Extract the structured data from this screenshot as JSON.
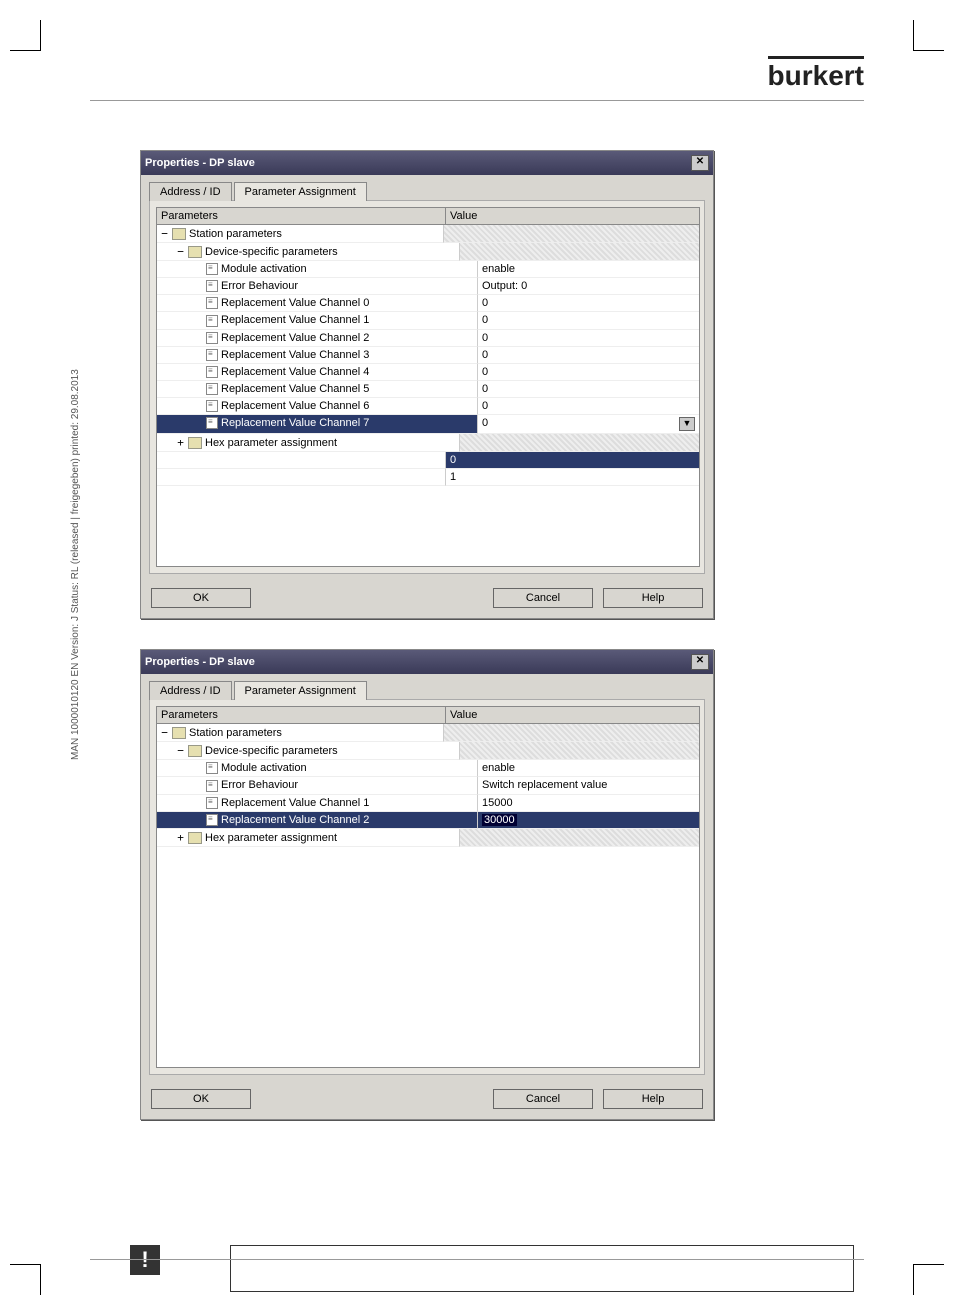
{
  "brand": "burkert",
  "sideText": "MAN 1000010120 EN Version: J Status: RL (released | freigegeben) printed: 29.08.2013",
  "dialog1": {
    "title": "Properties - DP slave",
    "tabs": [
      "Address / ID",
      "Parameter Assignment"
    ],
    "activeTab": 1,
    "head": {
      "c1": "Parameters",
      "c2": "Value"
    },
    "rows": [
      {
        "indent": 0,
        "type": "folder",
        "exp": "−",
        "label": "Station parameters",
        "value": "",
        "hashed": true
      },
      {
        "indent": 1,
        "type": "folder",
        "exp": "−",
        "label": "Device-specific parameters",
        "value": "",
        "hashed": true
      },
      {
        "indent": 2,
        "type": "leaf",
        "label": "Module activation",
        "value": "enable"
      },
      {
        "indent": 2,
        "type": "leaf",
        "label": "Error Behaviour",
        "value": "Output: 0"
      },
      {
        "indent": 2,
        "type": "leaf",
        "label": "Replacement Value Channel 0",
        "value": "0"
      },
      {
        "indent": 2,
        "type": "leaf",
        "label": "Replacement Value Channel 1",
        "value": "0"
      },
      {
        "indent": 2,
        "type": "leaf",
        "label": "Replacement Value Channel 2",
        "value": "0"
      },
      {
        "indent": 2,
        "type": "leaf",
        "label": "Replacement Value Channel 3",
        "value": "0"
      },
      {
        "indent": 2,
        "type": "leaf",
        "label": "Replacement Value Channel 4",
        "value": "0"
      },
      {
        "indent": 2,
        "type": "leaf",
        "label": "Replacement Value Channel 5",
        "value": "0"
      },
      {
        "indent": 2,
        "type": "leaf",
        "label": "Replacement Value Channel 6",
        "value": "0"
      },
      {
        "indent": 2,
        "type": "leaf",
        "label": "Replacement Value Channel 7",
        "value": "0",
        "dropdown": true,
        "selected": true
      },
      {
        "indent": 1,
        "type": "folder",
        "exp": "+",
        "label": "Hex parameter assignment",
        "value": "",
        "hashed": true
      }
    ],
    "dropdownOptions": [
      "0",
      "1"
    ],
    "ok": "OK",
    "cancel": "Cancel",
    "help": "Help"
  },
  "dialog2": {
    "title": "Properties - DP slave",
    "tabs": [
      "Address / ID",
      "Parameter Assignment"
    ],
    "activeTab": 1,
    "head": {
      "c1": "Parameters",
      "c2": "Value"
    },
    "rows": [
      {
        "indent": 0,
        "type": "folder",
        "exp": "−",
        "label": "Station parameters",
        "value": "",
        "hashed": true
      },
      {
        "indent": 1,
        "type": "folder",
        "exp": "−",
        "label": "Device-specific parameters",
        "value": "",
        "hashed": true
      },
      {
        "indent": 2,
        "type": "leaf",
        "label": "Module activation",
        "value": "enable"
      },
      {
        "indent": 2,
        "type": "leaf",
        "label": "Error Behaviour",
        "value": "Switch replacement value"
      },
      {
        "indent": 2,
        "type": "leaf",
        "label": "Replacement Value Channel 1",
        "value": "15000"
      },
      {
        "indent": 2,
        "type": "leaf",
        "label": "Replacement Value Channel 2",
        "value": "30000",
        "selected": true,
        "editbox": true
      },
      {
        "indent": 1,
        "type": "folder",
        "exp": "+",
        "label": "Hex parameter assignment",
        "value": "",
        "hashed": true
      }
    ],
    "ok": "OK",
    "cancel": "Cancel",
    "help": "Help"
  }
}
